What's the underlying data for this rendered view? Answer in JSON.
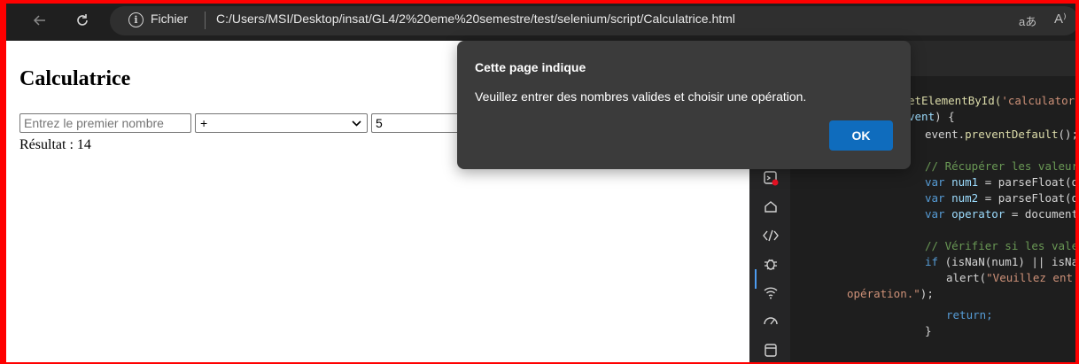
{
  "browser": {
    "back_icon": "arrow-left-icon",
    "refresh_icon": "refresh-icon",
    "info_icon": "info-icon",
    "scheme_label": "Fichier",
    "url": "C:/Users/MSI/Desktop/insat/GL4/2%20eme%20semestre/test/selenium/script/Calculatrice.html",
    "read_aloud_glyph": "aあ",
    "text_size_glyph": "A⁾"
  },
  "page": {
    "title": "Calculatrice",
    "num1_placeholder": "Entrez le premier nombre",
    "operator_value": "+",
    "num2_value": "5",
    "result_text": "Résultat : 14"
  },
  "dialog": {
    "title": "Cette page indique",
    "message": "Veuillez entrer des nombres valides et choisir une opération.",
    "ok_label": "OK"
  },
  "devtools": {
    "code": {
      "l1a": "etElementById(",
      "l1b": "'calculator",
      "l2a": "vent",
      "l2b": ") {",
      "l3a": "event.",
      "l3b": "preventDefault",
      "l3c": "();",
      "l4": "// Récupérer les valeur",
      "l5a": "var ",
      "l5b": "num1",
      "l5c": " = parseFloat(d",
      "l6a": "var ",
      "l6b": "num2",
      "l6c": " = parseFloat(d",
      "l7a": "var ",
      "l7b": "operator",
      "l7c": " = document",
      "l8": "// Vérifier si les vale",
      "l9a": "if ",
      "l9b": "(isNaN(num1) || isNa",
      "l10a": "alert(",
      "l10b": "\"Veuillez ent",
      "l11a": "opération.\"",
      "l11b": ");",
      "l12": "return;",
      "l13": "}"
    }
  },
  "colors": {
    "border_red": "#ff0000",
    "dialog_bg": "#3b3b3b",
    "ok_blue": "#0f6cbd"
  }
}
